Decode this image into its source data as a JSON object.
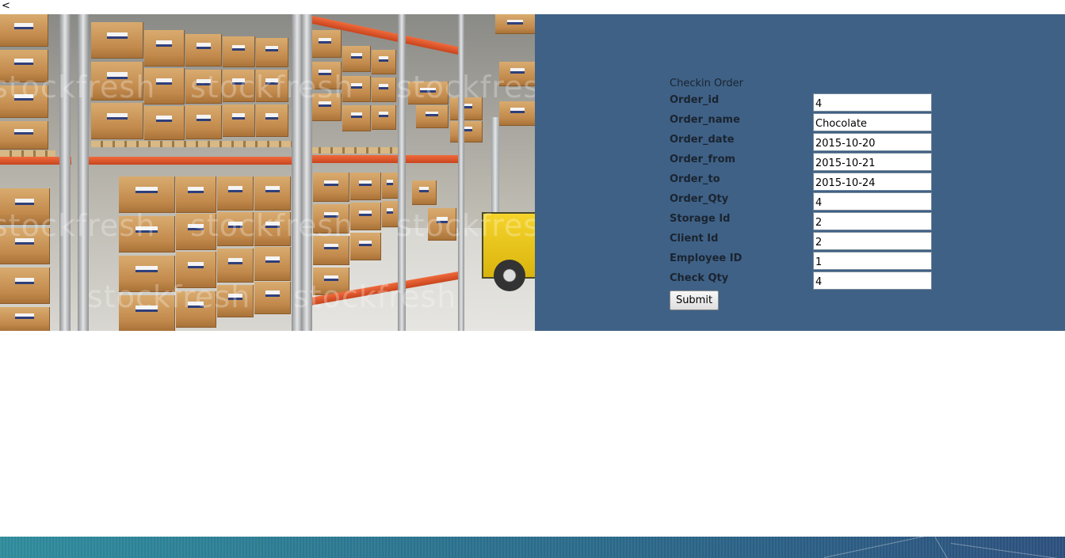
{
  "stray_char": "<",
  "photo": {
    "watermark_text": "stockfresh"
  },
  "form": {
    "title": "Checkin Order",
    "fields": [
      {
        "label": "Order_id",
        "value": "4"
      },
      {
        "label": "Order_name",
        "value": "Chocolate"
      },
      {
        "label": "Order_date",
        "value": "2015-10-20"
      },
      {
        "label": "Order_from",
        "value": "2015-10-21"
      },
      {
        "label": "Order_to",
        "value": "2015-10-24"
      },
      {
        "label": "Order_Qty",
        "value": "4"
      },
      {
        "label": "Storage Id",
        "value": "2"
      },
      {
        "label": "Client Id",
        "value": "2"
      },
      {
        "label": "Employee ID",
        "value": "1"
      },
      {
        "label": "Check Qty",
        "value": "4"
      }
    ],
    "submit_label": "Submit"
  },
  "colors": {
    "banner_bg": "#3f6186",
    "footer_start": "#2d8a9a",
    "footer_end": "#2b4f7c"
  }
}
